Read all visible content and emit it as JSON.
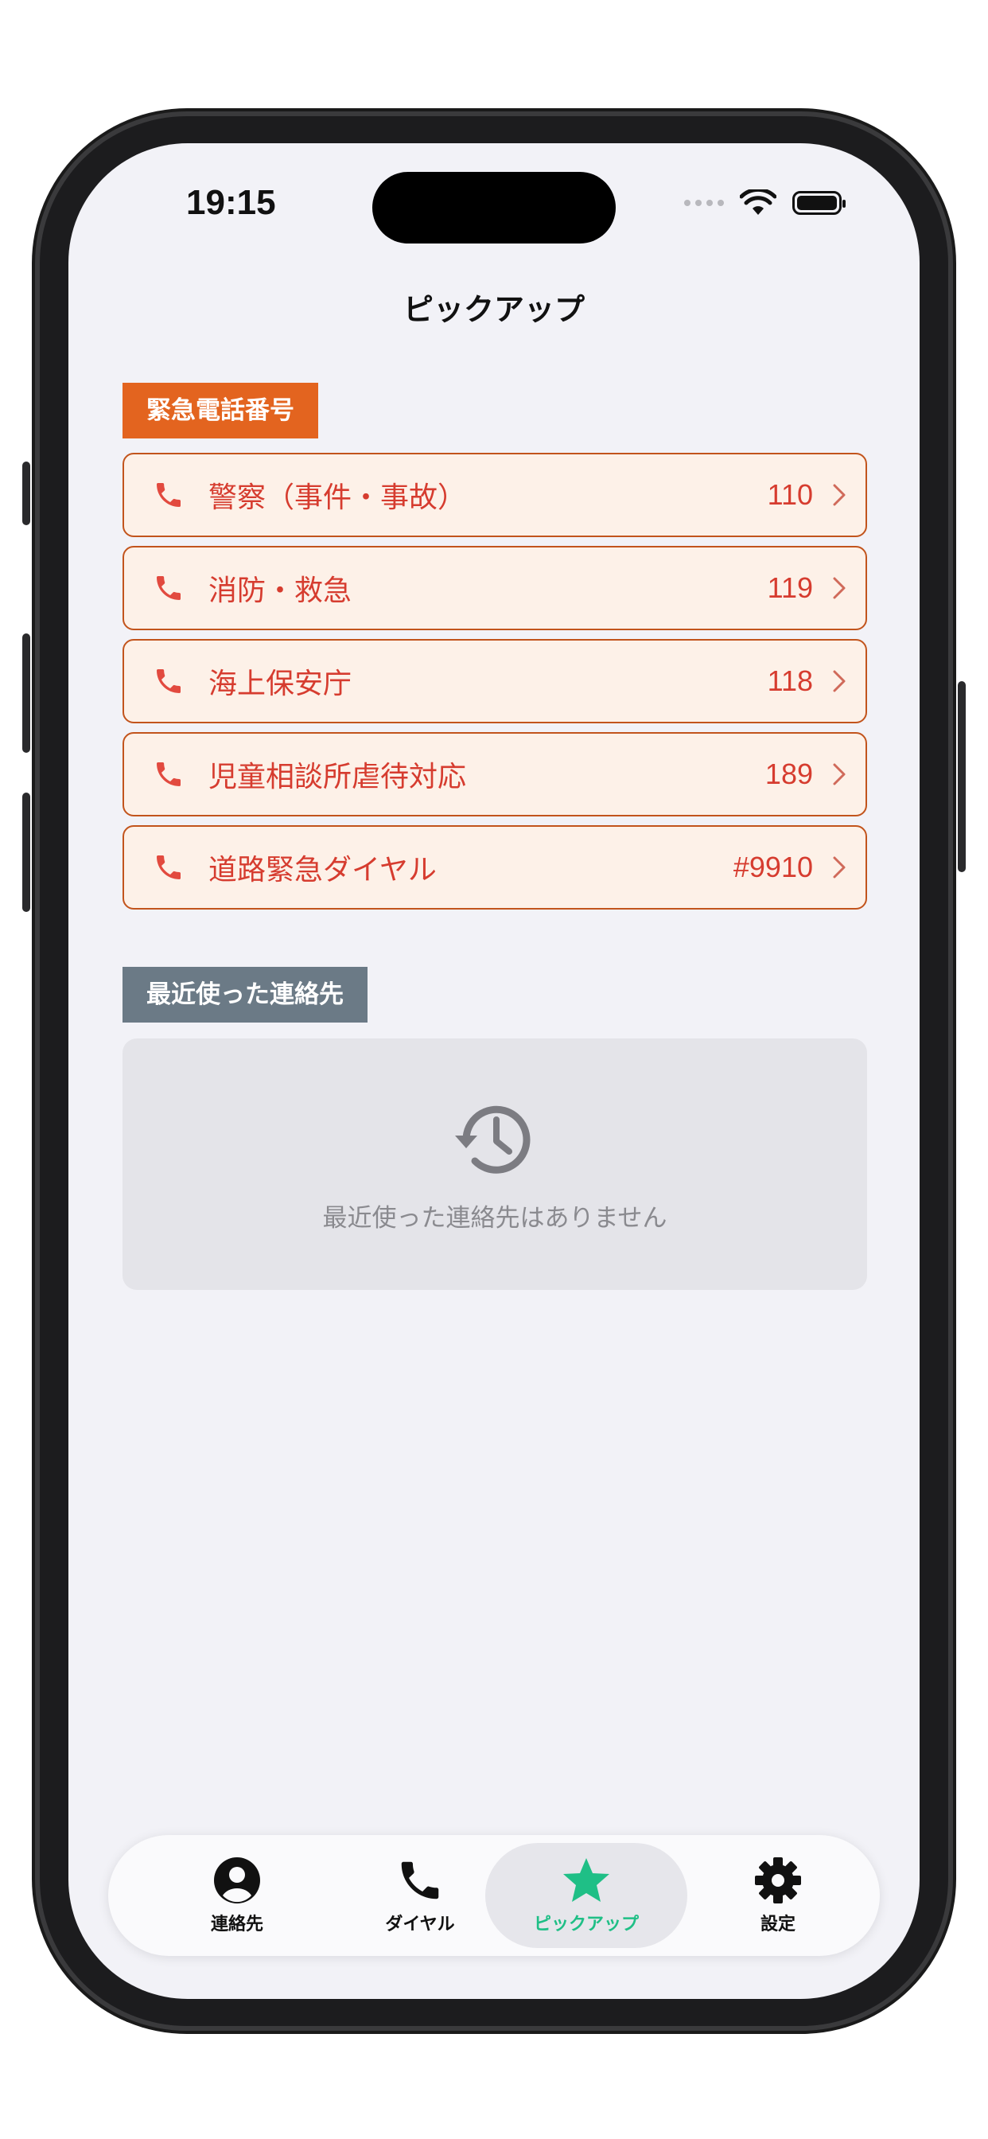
{
  "status_bar": {
    "time": "19:15"
  },
  "nav": {
    "title": "ピックアップ"
  },
  "emergency": {
    "label": "緊急電話番号",
    "items": [
      {
        "name": "警察（事件・事故）",
        "number": "110"
      },
      {
        "name": "消防・救急",
        "number": "119"
      },
      {
        "name": "海上保安庁",
        "number": "118"
      },
      {
        "name": "児童相談所虐待対応",
        "number": "189"
      },
      {
        "name": "道路緊急ダイヤル",
        "number": "#9910"
      }
    ]
  },
  "recent": {
    "label": "最近使った連絡先",
    "empty_text": "最近使った連絡先はありません"
  },
  "tabs": [
    {
      "label": "連絡先",
      "icon": "person-circle-icon"
    },
    {
      "label": "ダイヤル",
      "icon": "phone-icon"
    },
    {
      "label": "ピックアップ",
      "icon": "star-icon",
      "active": true
    },
    {
      "label": "設定",
      "icon": "gear-icon"
    }
  ],
  "colors": {
    "accent_orange": "#e3641f",
    "emergency_text": "#d63c2f",
    "recent_label": "#6b7a86",
    "active_tab": "#1fbf86"
  }
}
